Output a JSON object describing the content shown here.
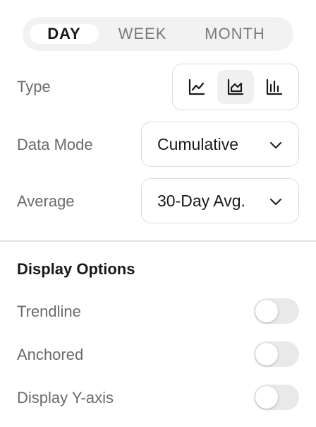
{
  "range_tabs": {
    "items": [
      {
        "label": "DAY",
        "active": true
      },
      {
        "label": "WEEK",
        "active": false
      },
      {
        "label": "MONTH",
        "active": false
      }
    ]
  },
  "type": {
    "label": "Type",
    "options": [
      {
        "icon": "line-chart-icon",
        "active": false
      },
      {
        "icon": "area-chart-icon",
        "active": true
      },
      {
        "icon": "bar-chart-icon",
        "active": false
      }
    ]
  },
  "data_mode": {
    "label": "Data Mode",
    "value": "Cumulative"
  },
  "average": {
    "label": "Average",
    "value": "30-Day Avg."
  },
  "display_options": {
    "title": "Display Options",
    "items": [
      {
        "label": "Trendline",
        "on": false
      },
      {
        "label": "Anchored",
        "on": false
      },
      {
        "label": "Display Y-axis",
        "on": false
      }
    ]
  },
  "colors": {
    "active_tab_bg": "#ffffff",
    "segment_bg": "#f2f2f2",
    "toggle_off": "#e9e9e9",
    "border": "#dcdcdc"
  }
}
